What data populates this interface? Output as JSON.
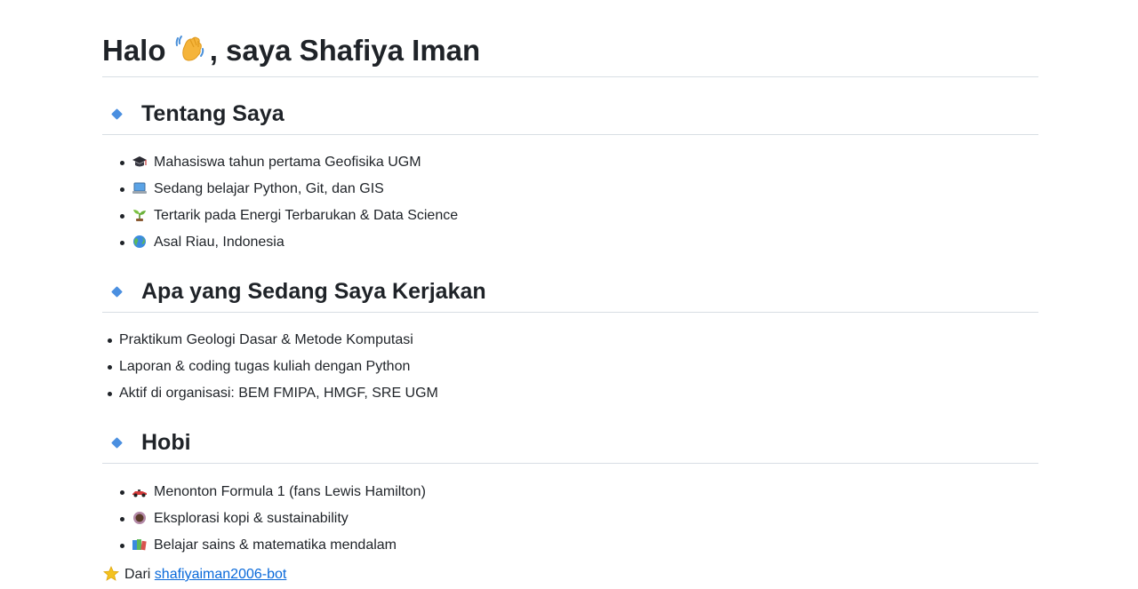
{
  "title": {
    "before": "Halo ",
    "emoji": "waving-hand",
    "after": ", saya Shafiya Iman"
  },
  "sections": [
    {
      "heading": "Tentang Saya",
      "items": [
        {
          "icon": "graduation-cap-icon",
          "text": "Mahasiswa tahun pertama Geofisika UGM"
        },
        {
          "icon": "laptop-icon",
          "text": "Sedang belajar Python, Git, dan GIS"
        },
        {
          "icon": "seedling-icon",
          "text": "Tertarik pada Energi Terbarukan & Data Science"
        },
        {
          "icon": "globe-icon",
          "text": "Asal Riau, Indonesia"
        }
      ]
    },
    {
      "heading": "Apa yang Sedang Saya Kerjakan",
      "items": [
        {
          "text": "Praktikum Geologi Dasar & Metode Komputasi"
        },
        {
          "text": "Laporan & coding tugas kuliah dengan Python"
        },
        {
          "text": "Aktif di organisasi: BEM FMIPA, HMGF, SRE UGM"
        }
      ]
    },
    {
      "heading": "Hobi",
      "items": [
        {
          "icon": "racing-car-icon",
          "text": "Menonton Formula 1 (fans Lewis Hamilton)"
        },
        {
          "icon": "coffee-icon",
          "text": "Eksplorasi kopi & sustainability"
        },
        {
          "icon": "books-icon",
          "text": "Belajar sains & matematika mendalam"
        }
      ]
    }
  ],
  "footer": {
    "icon": "star-icon",
    "prefix": "Dari",
    "link_text": "shafiyaiman2006-bot"
  },
  "colors": {
    "accent_diamond": "#4a8fe0",
    "link": "#0969da",
    "divider": "#d8dee4",
    "text": "#1f2328"
  }
}
